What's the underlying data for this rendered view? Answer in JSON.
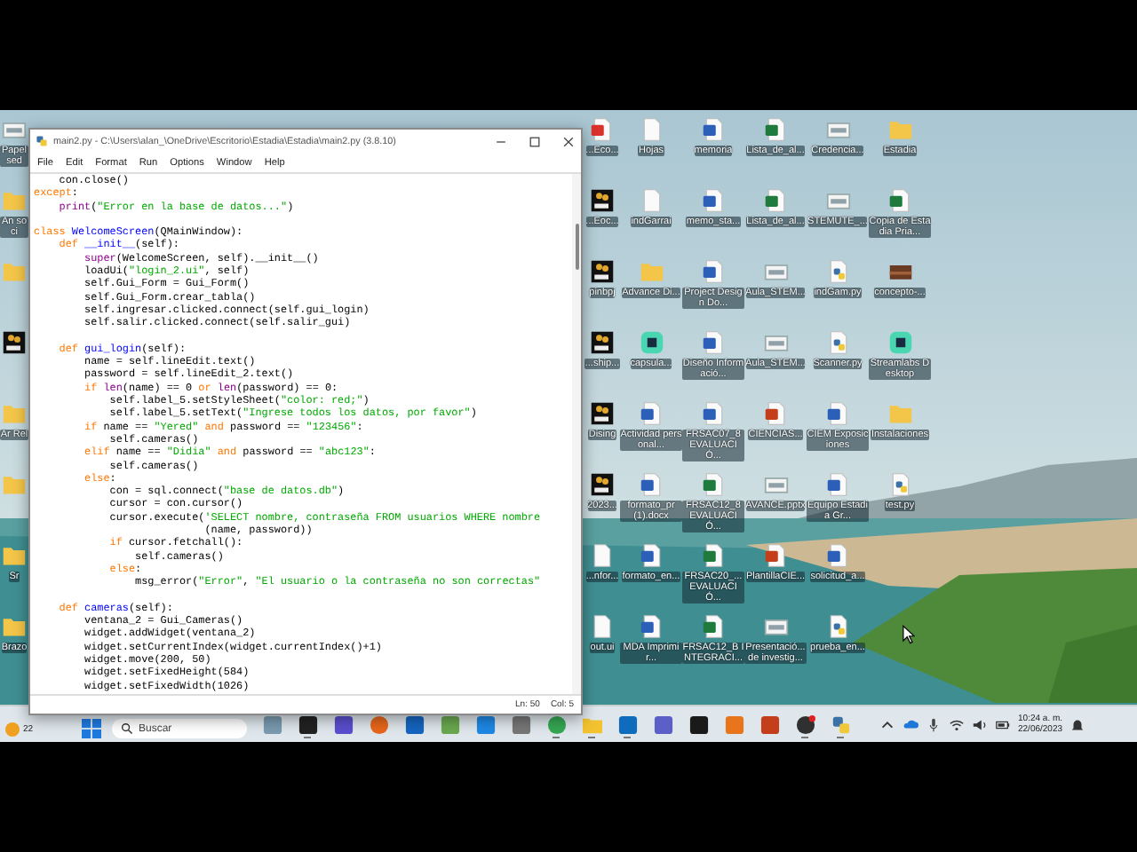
{
  "desktop": {
    "left_icons": [
      {
        "kind": "image",
        "label": "Papel sed"
      },
      {
        "kind": "folder",
        "label": "An soci"
      },
      {
        "kind": "folder"
      },
      {
        "kind": "wb"
      },
      {
        "kind": "folder",
        "label": "Ar Rel"
      },
      {
        "kind": "folder"
      },
      {
        "kind": "folder",
        "label": "Sr"
      },
      {
        "kind": "folder",
        "label": "Brazo"
      }
    ],
    "icons": [
      {
        "kind": "pdf",
        "label": "...Eco..."
      },
      {
        "kind": "file",
        "label": "Hojas"
      },
      {
        "kind": "word",
        "label": "memoria"
      },
      {
        "kind": "excel",
        "label": "Lista_de_al..."
      },
      {
        "kind": "image",
        "label": "Credencia..."
      },
      {
        "kind": "folder",
        "label": "Estadia"
      },
      {
        "kind": "wb",
        "label": "...Eoc..."
      },
      {
        "kind": "file",
        "label": "indGarrai"
      },
      {
        "kind": "word",
        "label": "memo_sta..."
      },
      {
        "kind": "excel",
        "label": "Lista_de_al..."
      },
      {
        "kind": "image",
        "label": "STEMUTE_..."
      },
      {
        "kind": "excel",
        "label": "Copia de Estadia Pria..."
      },
      {
        "kind": "wb",
        "label": "pinbpj"
      },
      {
        "kind": "folder",
        "label": "Advance Di..."
      },
      {
        "kind": "word",
        "label": "Project Design Do..."
      },
      {
        "kind": "image",
        "label": "Aula_STEM..."
      },
      {
        "kind": "python",
        "label": "indGam.py"
      },
      {
        "kind": "photo",
        "label": "concepto-..."
      },
      {
        "kind": "wb",
        "label": "...ship..."
      },
      {
        "kind": "app",
        "label": "capsula..."
      },
      {
        "kind": "word",
        "label": "Diseño Informació..."
      },
      {
        "kind": "image",
        "label": "Aula_STEM..."
      },
      {
        "kind": "python",
        "label": "Scanner.py"
      },
      {
        "kind": "app",
        "label": "Streamlabs Desktop"
      },
      {
        "kind": "wb",
        "label": "Dising"
      },
      {
        "kind": "word",
        "label": "Actividad personal..."
      },
      {
        "kind": "word",
        "label": "FRSAC07_8 EVALUACIÓ..."
      },
      {
        "kind": "ppt",
        "label": "CIENCIAS..."
      },
      {
        "kind": "word",
        "label": "CIEM Exposiciones"
      },
      {
        "kind": "folder",
        "label": "Instalaciones"
      },
      {
        "kind": "wb",
        "label": "2023..."
      },
      {
        "kind": "word",
        "label": "formato_pr (1).docx"
      },
      {
        "kind": "excel",
        "label": "FRSAC12_8 EVALUACIÓ..."
      },
      {
        "kind": "image",
        "label": "AVANCE.pptx"
      },
      {
        "kind": "word",
        "label": "Equipo Estadia Gr..."
      },
      {
        "kind": "python",
        "label": "test.py"
      },
      {
        "kind": "file",
        "label": "...nfor..."
      },
      {
        "kind": "word",
        "label": "formato_en..."
      },
      {
        "kind": "excel",
        "label": "FRSAC20_... EVALUACIÓ..."
      },
      {
        "kind": "ppt",
        "label": "PlantillaCIE..."
      },
      {
        "kind": "word",
        "label": "solicitud_a..."
      },
      {
        "kind": "none"
      },
      {
        "kind": "file",
        "label": "out.ui"
      },
      {
        "kind": "word",
        "label": "MDA Imprimir..."
      },
      {
        "kind": "excel",
        "label": "FRSAC12_B INTEGRACI..."
      },
      {
        "kind": "image",
        "label": "Presentació... de investig..."
      },
      {
        "kind": "python",
        "label": "prueba_en..."
      }
    ]
  },
  "window": {
    "title": "main2.py - C:\\Users\\alan_\\OneDrive\\Escritorio\\Estadia\\Estadia\\main2.py (3.8.10)",
    "menu": [
      "File",
      "Edit",
      "Format",
      "Run",
      "Options",
      "Window",
      "Help"
    ],
    "code_lines": [
      {
        "blank_before": false,
        "tokens": [
          {
            "kind": "plain",
            "text": "    con.close()"
          }
        ]
      },
      {
        "blank_before": false,
        "tokens": [
          {
            "kind": "keyword",
            "text": "except"
          },
          {
            "kind": "plain",
            "text": ":"
          }
        ]
      },
      {
        "blank_before": false,
        "tokens": [
          {
            "kind": "builtin",
            "text": "    print"
          },
          {
            "kind": "plain",
            "text": "("
          },
          {
            "kind": "string",
            "text": "\"Error en la base de datos...\""
          },
          {
            "kind": "plain",
            "text": ")"
          }
        ]
      },
      {
        "blank_before": true,
        "tokens": [
          {
            "kind": "keyword",
            "text": "class "
          },
          {
            "kind": "definition",
            "text": "WelcomeScreen"
          },
          {
            "kind": "plain",
            "text": "(QMainWindow):"
          }
        ]
      },
      {
        "blank_before": false,
        "tokens": [
          {
            "kind": "keyword",
            "text": "    def "
          },
          {
            "kind": "definition",
            "text": "__init__"
          },
          {
            "kind": "plain",
            "text": "(self):"
          }
        ]
      },
      {
        "blank_before": false,
        "tokens": [
          {
            "kind": "builtin",
            "text": "        super"
          },
          {
            "kind": "plain",
            "text": "(WelcomeScreen, self).__init__()"
          }
        ]
      },
      {
        "blank_before": false,
        "tokens": [
          {
            "kind": "plain",
            "text": "        loadUi("
          },
          {
            "kind": "string",
            "text": "\"login_2.ui\""
          },
          {
            "kind": "plain",
            "text": ", self)"
          }
        ]
      },
      {
        "blank_before": false,
        "tokens": [
          {
            "kind": "plain",
            "text": "        self.Gui_Form = Gui_Form()"
          }
        ]
      },
      {
        "blank_before": false,
        "tokens": [
          {
            "kind": "plain",
            "text": "        self.Gui_Form.crear_tabla()"
          }
        ]
      },
      {
        "blank_before": false,
        "tokens": [
          {
            "kind": "plain",
            "text": "        self.ingresar.clicked.connect(self.gui_login)"
          }
        ]
      },
      {
        "blank_before": false,
        "tokens": [
          {
            "kind": "plain",
            "text": "        self.salir.clicked.connect(self.salir_gui)"
          }
        ]
      },
      {
        "blank_before": true,
        "tokens": [
          {
            "kind": "keyword",
            "text": "    def "
          },
          {
            "kind": "definition",
            "text": "gui_login"
          },
          {
            "kind": "plain",
            "text": "(self):"
          }
        ]
      },
      {
        "blank_before": false,
        "tokens": [
          {
            "kind": "plain",
            "text": "        name = self.lineEdit.text()"
          }
        ]
      },
      {
        "blank_before": false,
        "tokens": [
          {
            "kind": "plain",
            "text": "        password = self.lineEdit_2.text()"
          }
        ]
      },
      {
        "blank_before": false,
        "tokens": [
          {
            "kind": "keyword",
            "text": "        if "
          },
          {
            "kind": "builtin",
            "text": "len"
          },
          {
            "kind": "plain",
            "text": "(name) == 0 "
          },
          {
            "kind": "keyword",
            "text": "or "
          },
          {
            "kind": "builtin",
            "text": "len"
          },
          {
            "kind": "plain",
            "text": "(password) == 0:"
          }
        ]
      },
      {
        "blank_before": false,
        "tokens": [
          {
            "kind": "plain",
            "text": "            self.label_5.setStyleSheet("
          },
          {
            "kind": "string",
            "text": "\"color: red;\""
          },
          {
            "kind": "plain",
            "text": ")"
          }
        ]
      },
      {
        "blank_before": false,
        "tokens": [
          {
            "kind": "plain",
            "text": "            self.label_5.setText("
          },
          {
            "kind": "string",
            "text": "\"Ingrese todos los datos, por favor\""
          },
          {
            "kind": "plain",
            "text": ")"
          }
        ]
      },
      {
        "blank_before": false,
        "tokens": [
          {
            "kind": "keyword",
            "text": "        if "
          },
          {
            "kind": "plain",
            "text": "name == "
          },
          {
            "kind": "string",
            "text": "\"Yered\""
          },
          {
            "kind": "keyword",
            "text": " and "
          },
          {
            "kind": "plain",
            "text": "password == "
          },
          {
            "kind": "string",
            "text": "\"123456\""
          },
          {
            "kind": "plain",
            "text": ":"
          }
        ]
      },
      {
        "blank_before": false,
        "tokens": [
          {
            "kind": "plain",
            "text": "            self.cameras()"
          }
        ]
      },
      {
        "blank_before": false,
        "tokens": [
          {
            "kind": "keyword",
            "text": "        elif "
          },
          {
            "kind": "plain",
            "text": "name == "
          },
          {
            "kind": "string",
            "text": "\"Didia\""
          },
          {
            "kind": "keyword",
            "text": " and "
          },
          {
            "kind": "plain",
            "text": "password == "
          },
          {
            "kind": "string",
            "text": "\"abc123\""
          },
          {
            "kind": "plain",
            "text": ":"
          }
        ]
      },
      {
        "blank_before": false,
        "tokens": [
          {
            "kind": "plain",
            "text": "            self.cameras()"
          }
        ]
      },
      {
        "blank_before": false,
        "tokens": [
          {
            "kind": "keyword",
            "text": "        else"
          },
          {
            "kind": "plain",
            "text": ":"
          }
        ]
      },
      {
        "blank_before": false,
        "tokens": [
          {
            "kind": "plain",
            "text": "            con = sql.connect("
          },
          {
            "kind": "string",
            "text": "\"base de datos.db\""
          },
          {
            "kind": "plain",
            "text": ")"
          }
        ]
      },
      {
        "blank_before": false,
        "tokens": [
          {
            "kind": "plain",
            "text": "            cursor = con.cursor()"
          }
        ]
      },
      {
        "blank_before": false,
        "tokens": [
          {
            "kind": "plain",
            "text": "            cursor.execute("
          },
          {
            "kind": "string",
            "text": "'SELECT nombre, contraseña FROM usuarios WHERE nombre"
          }
        ]
      },
      {
        "blank_before": false,
        "tokens": [
          {
            "kind": "plain",
            "text": "                           (name, password))"
          }
        ]
      },
      {
        "blank_before": false,
        "tokens": [
          {
            "kind": "keyword",
            "text": "            if "
          },
          {
            "kind": "plain",
            "text": "cursor.fetchall():"
          }
        ]
      },
      {
        "blank_before": false,
        "tokens": [
          {
            "kind": "plain",
            "text": "                self.cameras()"
          }
        ]
      },
      {
        "blank_before": false,
        "tokens": [
          {
            "kind": "keyword",
            "text": "            else"
          },
          {
            "kind": "plain",
            "text": ":"
          }
        ]
      },
      {
        "blank_before": false,
        "tokens": [
          {
            "kind": "plain",
            "text": "                msg_error("
          },
          {
            "kind": "string",
            "text": "\"Error\""
          },
          {
            "kind": "plain",
            "text": ", "
          },
          {
            "kind": "string",
            "text": "\"El usuario o la contraseña no son correctas\""
          }
        ]
      },
      {
        "blank_before": true,
        "tokens": [
          {
            "kind": "keyword",
            "text": "    def "
          },
          {
            "kind": "definition",
            "text": "cameras"
          },
          {
            "kind": "plain",
            "text": "(self):"
          }
        ]
      },
      {
        "blank_before": false,
        "tokens": [
          {
            "kind": "plain",
            "text": "        ventana_2 = Gui_Cameras()"
          }
        ]
      },
      {
        "blank_before": false,
        "tokens": [
          {
            "kind": "plain",
            "text": "        widget.addWidget(ventana_2)"
          }
        ]
      },
      {
        "blank_before": false,
        "tokens": [
          {
            "kind": "plain",
            "text": "        widget.setCurrentIndex(widget.currentIndex()+1)"
          }
        ]
      },
      {
        "blank_before": false,
        "tokens": [
          {
            "kind": "plain",
            "text": "        widget.move(200, 50)"
          }
        ]
      },
      {
        "blank_before": false,
        "tokens": [
          {
            "kind": "plain",
            "text": "        widget.setFixedHeight(584)"
          }
        ]
      },
      {
        "blank_before": false,
        "tokens": [
          {
            "kind": "plain",
            "text": "        widget.setFixedWidth(1026)"
          }
        ]
      }
    ],
    "status_bar": {
      "line": "Ln: 50",
      "column": "Col: 5"
    }
  },
  "taskbar": {
    "weather": "22",
    "search": {
      "placeholder": "Buscar"
    },
    "apps": [
      {
        "kind": "widget",
        "running": false
      },
      {
        "kind": "terminal",
        "running": true
      },
      {
        "kind": "chat",
        "running": false
      },
      {
        "kind": "browser",
        "running": false
      },
      {
        "kind": "store",
        "running": false
      },
      {
        "kind": "green-app",
        "running": false
      },
      {
        "kind": "blue-app",
        "running": false
      },
      {
        "kind": "settings",
        "running": false
      },
      {
        "kind": "chrome",
        "running": true
      },
      {
        "kind": "folder",
        "running": true
      },
      {
        "kind": "mail",
        "running": true
      },
      {
        "kind": "teams",
        "running": false
      },
      {
        "kind": "ide",
        "running": false
      },
      {
        "kind": "f-app",
        "running": false
      },
      {
        "kind": "slides",
        "running": false
      },
      {
        "kind": "recorder",
        "running": true
      },
      {
        "kind": "python",
        "running": true
      }
    ],
    "clock": {
      "time": "10:24 a. m.",
      "date": "22/06/2023"
    }
  }
}
